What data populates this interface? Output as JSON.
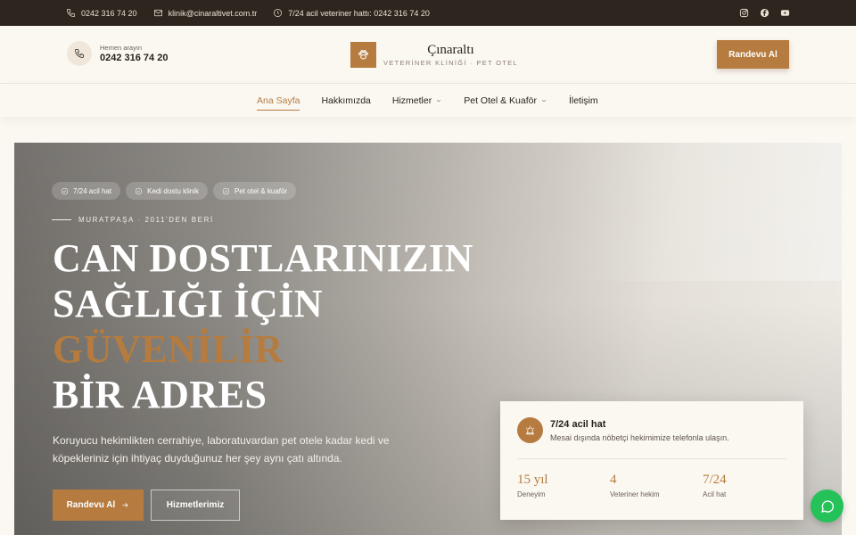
{
  "topbar": {
    "phone": "0242 316 74 20",
    "email": "klinik@cinaraltivet.com.tr",
    "emergency": "7/24 acil veteriner hattı: 0242 316 74 20",
    "social": [
      "instagram-icon",
      "facebook-icon",
      "youtube-icon"
    ]
  },
  "header": {
    "call_label": "Hemen arayın",
    "call_number": "0242 316 74 20",
    "brand_name": "Çınaraltı",
    "brand_sub": "VETERİNER KLİNİĞİ · PET OTEL",
    "cta": "Randevu Al"
  },
  "nav": {
    "items": [
      {
        "label": "Ana Sayfa",
        "active": true
      },
      {
        "label": "Hakkımızda"
      },
      {
        "label": "Hizmetler",
        "dropdown": true
      },
      {
        "label": "Pet Otel & Kuaför",
        "dropdown": true
      },
      {
        "label": "İletişim"
      }
    ]
  },
  "hero": {
    "chips": [
      "7/24 acil hat",
      "Kedi dostu klinik",
      "Pet otel & kuaför"
    ],
    "eyebrow": "MURATPAŞA · 2011'DEN BERİ",
    "headline": {
      "line1": "CAN DOSTLARINIZIN",
      "line2": "SAĞLIĞI İÇİN",
      "line3": "GÜVENİLİR",
      "line4": "BİR ADRES"
    },
    "lead": "Koruyucu hekimlikten cerrahiye, laboratuvardan pet otele kadar kedi ve köpekleriniz için ihtiyaç duyduğunuz her şey aynı çatı altında.",
    "primary_button": "Randevu Al",
    "secondary_button": "Hizmetlerimiz"
  },
  "info_card": {
    "title": "7/24 acil hat",
    "desc": "Mesai dışında nöbetçi hekimimize telefonla ulaşın.",
    "stats": [
      {
        "value": "15 yıl",
        "label": "Deneyim"
      },
      {
        "value": "4",
        "label": "Veteriner hekim"
      },
      {
        "value": "7/24",
        "label": "Acil hat"
      }
    ]
  },
  "colors": {
    "accent": "#b57b3f",
    "topbar": "#2e261e",
    "background": "#fbf8f2",
    "chat": "#25c25a"
  }
}
